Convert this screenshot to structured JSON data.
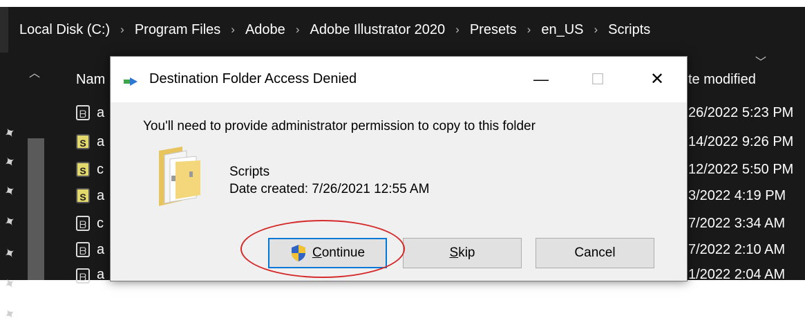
{
  "breadcrumb": {
    "items": [
      "Local Disk (C:)",
      "Program Files",
      "Adobe",
      "Adobe Illustrator 2020",
      "Presets",
      "en_US",
      "Scripts"
    ],
    "separator": "›"
  },
  "columns": {
    "name": "Nam",
    "date_modified": "te modified"
  },
  "files": [
    {
      "icon": "script-file-icon",
      "name": "a",
      "date": "26/2022 5:23 PM"
    },
    {
      "icon": "js-file-icon",
      "name": "a",
      "date": "14/2022 9:26 PM"
    },
    {
      "icon": "js-file-icon",
      "name": "c",
      "date": "12/2022 5:50 PM"
    },
    {
      "icon": "js-file-icon",
      "name": "a",
      "date": "3/2022 4:19 PM"
    },
    {
      "icon": "script-file-icon",
      "name": "c",
      "date": "7/2022 3:34 AM"
    },
    {
      "icon": "script-file-icon",
      "name": "a",
      "date": "7/2022 2:10 AM"
    },
    {
      "icon": "script-file-icon",
      "name": "a",
      "date": "1/2022 2:04 AM"
    }
  ],
  "dialog": {
    "title": "Destination Folder Access Denied",
    "message": "You'll need to provide administrator permission to copy to this folder",
    "folder_name": "Scripts",
    "folder_date": "Date created: 7/26/2021 12:55 AM",
    "buttons": {
      "continue_first": "C",
      "continue_rest": "ontinue",
      "skip_first": "S",
      "skip_rest": "kip",
      "cancel": "Cancel"
    },
    "controls": {
      "minimize": "—",
      "maximize": "☐",
      "close": "✕"
    }
  },
  "colors": {
    "explorer_bg": "#191919",
    "dialog_bg": "#f0f0f0",
    "focus_border": "#0078d7",
    "annotation": "#d62a2a"
  }
}
